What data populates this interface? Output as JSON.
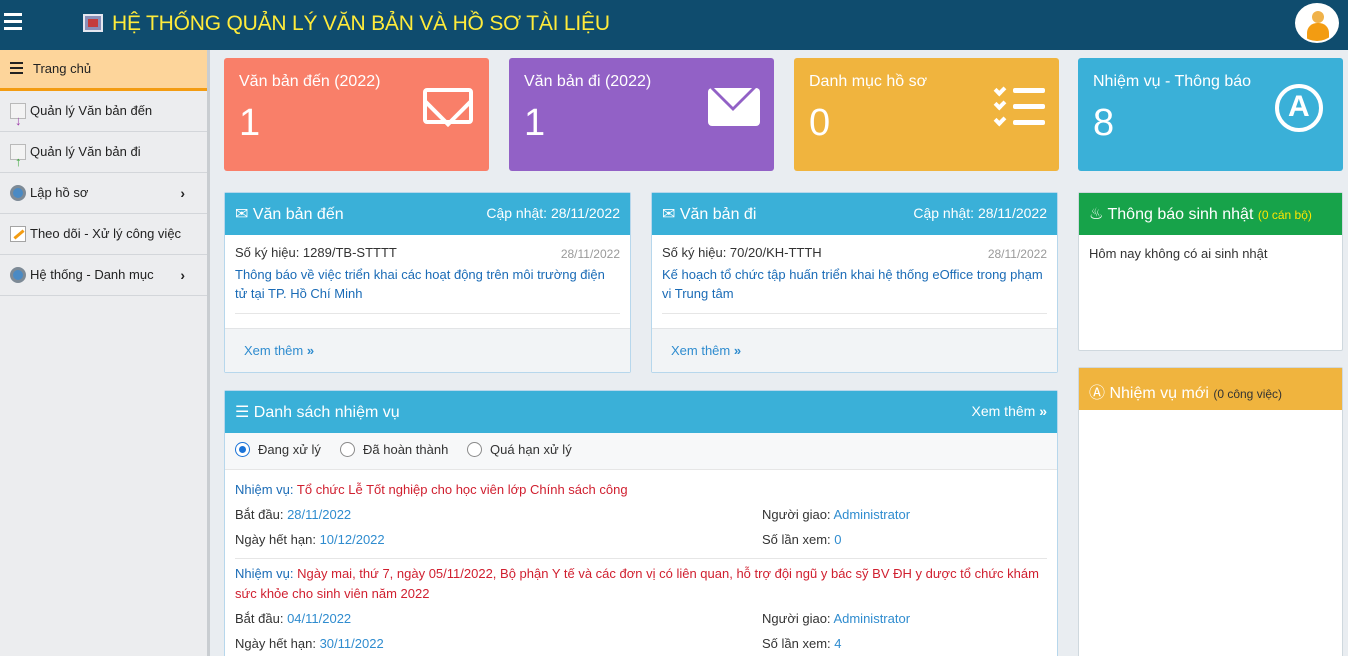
{
  "header": {
    "title": "HỆ THỐNG QUẢN LÝ VĂN BẢN VÀ HỒ SƠ TÀI LIỆU"
  },
  "sidebar": {
    "items": [
      {
        "label": "Trang chủ",
        "icon": "menu-icon"
      },
      {
        "label": "Quản lý Văn bản đến",
        "icon": "incoming-doc-icon"
      },
      {
        "label": "Quản lý Văn bản đi",
        "icon": "outgoing-doc-icon"
      },
      {
        "label": "Lập hồ sơ",
        "icon": "gear-icon",
        "chevron": "›"
      },
      {
        "label": "Theo dõi - Xử lý công việc",
        "icon": "pen-icon"
      },
      {
        "label": "Hệ thống - Danh mục",
        "icon": "gear-icon",
        "chevron": "›"
      }
    ]
  },
  "stats": [
    {
      "label": "Văn bản đến (2022)",
      "value": "1",
      "color": "#f97f69",
      "icon": "envelope-outline-icon"
    },
    {
      "label": "Văn bản đi (2022)",
      "value": "1",
      "color": "#9261c6",
      "icon": "envelope-icon"
    },
    {
      "label": "Danh mục hồ sơ",
      "value": "0",
      "color": "#f0b43e",
      "icon": "checklist-icon"
    },
    {
      "label": "Nhiệm vụ - Thông báo",
      "value": "8",
      "color": "#3ab0d8",
      "icon": "app-store-icon"
    }
  ],
  "incoming": {
    "title": "Văn bản đến",
    "updated": "Cập nhật: 28/11/2022",
    "meta": "Số ký hiệu: 1289/TB-STTTT",
    "date": "28/11/2022",
    "link": "Thông báo về việc triển khai các hoạt động trên môi trường điện tử tại TP. Hồ Chí Minh",
    "more": "Xem thêm"
  },
  "outgoing": {
    "title": "Văn bản đi",
    "updated": "Cập nhật: 28/11/2022",
    "meta": "Số ký hiệu: 70/20/KH-TTTH",
    "date": "28/11/2022",
    "link": "Kế hoạch tổ chức tập huấn triển khai hệ thống eOffice trong phạm vi Trung tâm",
    "more": "Xem thêm"
  },
  "tasks": {
    "title": "Danh sách nhiệm vụ",
    "more": "Xem thêm",
    "filters": [
      "Đang xử lý",
      "Đã hoàn thành",
      "Quá hạn xử lý"
    ],
    "labels": {
      "task": "Nhiệm vụ:",
      "start": "Bắt đầu:",
      "deadline": "Ngày hết hạn:",
      "assigner": "Người giao:",
      "views": "Số lần xem:"
    },
    "items": [
      {
        "name": "Tổ chức Lễ Tốt nghiệp cho học viên lớp Chính sách công",
        "start": "28/11/2022",
        "deadline": "10/12/2022",
        "assigner": "Administrator",
        "views": "0"
      },
      {
        "name": "Ngày mai, thứ 7, ngày 05/11/2022, Bộ phận Y tế và các đơn vị có liên quan, hỗ trợ đội ngũ y bác sỹ BV ĐH y dược tổ chức khám sức khỏe cho sinh viên năm 2022",
        "start": "04/11/2022",
        "deadline": "30/11/2022",
        "assigner": "Administrator",
        "views": "4"
      }
    ]
  },
  "birthday": {
    "title": "Thông báo sinh nhật",
    "count": "(0 cán bộ)",
    "message": "Hôm nay không có ai sinh nhật"
  },
  "new_tasks": {
    "title": "Nhiệm vụ mới",
    "count": "(0 công việc)"
  }
}
